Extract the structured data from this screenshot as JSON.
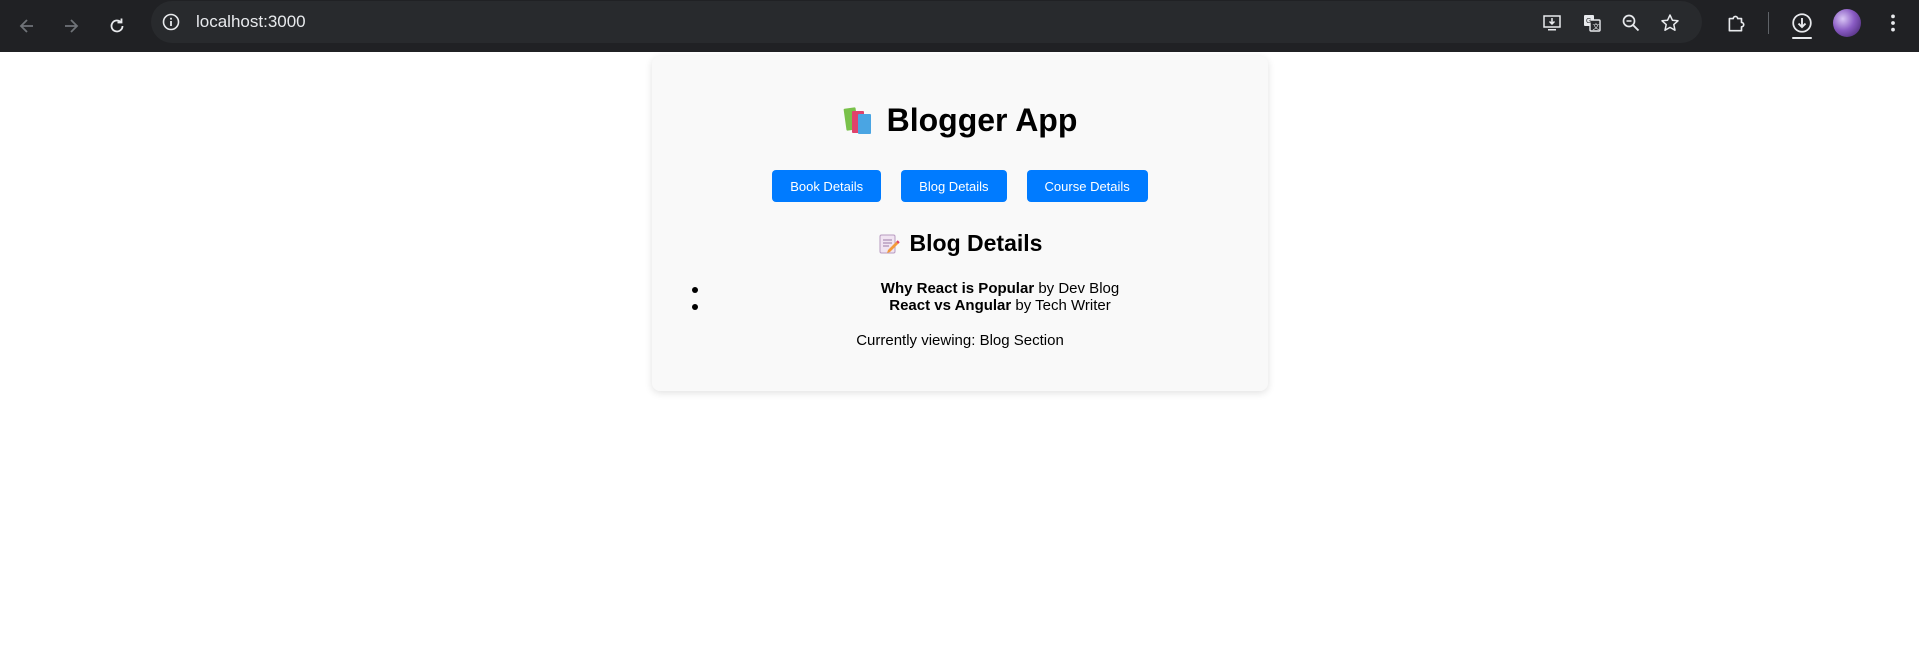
{
  "browser": {
    "url": "localhost:3000"
  },
  "page": {
    "title": "Blogger App",
    "buttons": [
      "Book Details",
      "Blog Details",
      "Course Details"
    ],
    "section_title": "Blog Details",
    "posts": [
      {
        "title": "Why React is Popular",
        "author": "Dev Blog",
        "by": "by"
      },
      {
        "title": "React vs Angular",
        "author": "Tech Writer",
        "by": "by"
      }
    ],
    "status": "Currently viewing: Blog Section"
  },
  "colors": {
    "button": "#007bff",
    "chrome_bg": "#202124"
  }
}
